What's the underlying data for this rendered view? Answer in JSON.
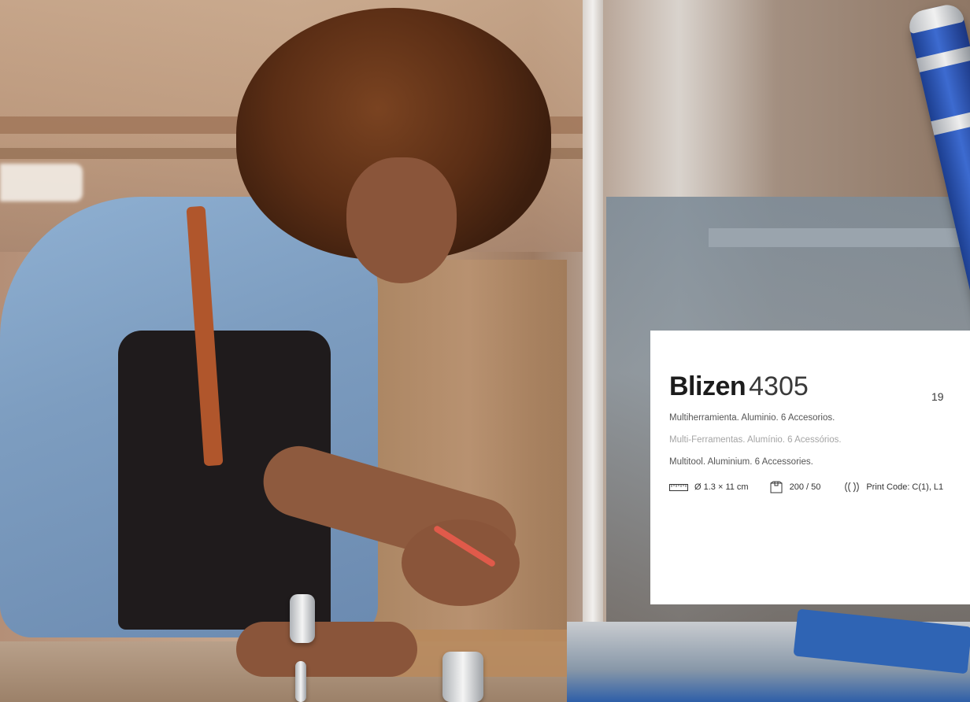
{
  "product": {
    "name": "Blizen",
    "code": "4305",
    "page_number": "19",
    "descriptions": {
      "es": "Multiherramienta. Aluminio. 6 Accesorios.",
      "pt": "Multi-Ferramentas. Alumínio. 6 Acessórios.",
      "en": "Multitool. Aluminium. 6 Accessories."
    },
    "specs": [
      {
        "icon": "ruler-icon",
        "value": "Ø 1.3 × 11 cm"
      },
      {
        "icon": "box-icon",
        "value": "200 / 50"
      },
      {
        "icon": "print-icon",
        "value": "Print Code: C(1), L1"
      }
    ]
  },
  "colors": {
    "card_bg": "#ffffff",
    "tool_blue": "#2f5fc4",
    "text_dark": "#1c1c1c",
    "text_muted": "#a5a5a5"
  }
}
